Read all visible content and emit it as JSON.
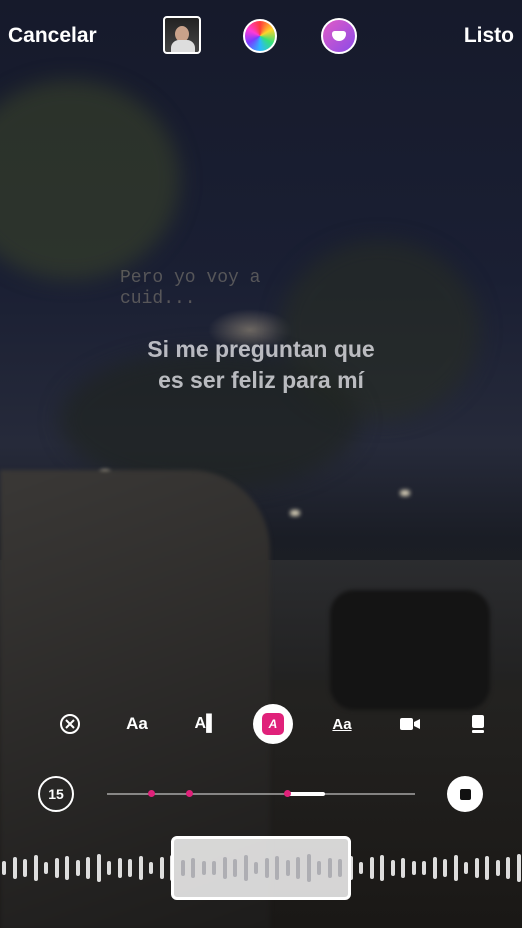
{
  "header": {
    "cancel_label": "Cancelar",
    "done_label": "Listo",
    "album_thumb_text": "",
    "icons": [
      "album-cover-thumbnail",
      "color-wheel-icon",
      "sticker-face-icon"
    ]
  },
  "lyrics": {
    "ghost_line1": "Pero yo voy a",
    "ghost_line2": "cuid...",
    "line1": "Si me preguntan que",
    "line2": "es ser feliz para mí"
  },
  "tools": {
    "close_icon": "⊗",
    "font_size_label": "Aa",
    "font_style_label": "A▌",
    "active_style_label": "A",
    "text_style_label": "Aa",
    "video_icon": "video-icon",
    "card_icon": "card-icon"
  },
  "timeline": {
    "duration_label": "15",
    "playhead_fraction": 0.584,
    "selection_fraction": [
      0.584,
      0.708
    ],
    "markers": [
      0.143,
      0.269,
      0.584
    ]
  },
  "colors": {
    "accent": "#e0217a",
    "text": "#ffffff"
  }
}
